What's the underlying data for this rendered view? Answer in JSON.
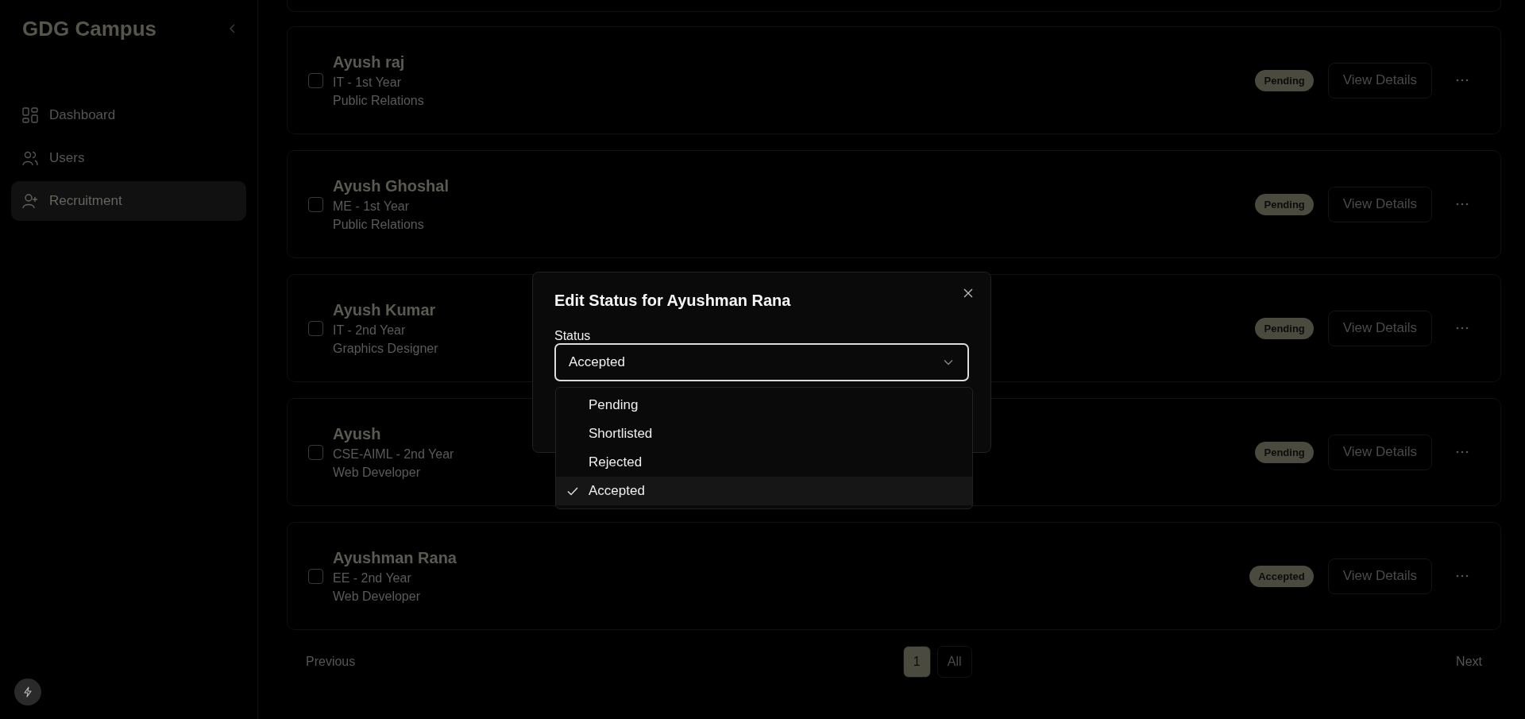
{
  "sidebar": {
    "title": "GDG Campus",
    "items": [
      {
        "label": "Dashboard",
        "selected": false
      },
      {
        "label": "Users",
        "selected": false
      },
      {
        "label": "Recruitment",
        "selected": true
      }
    ]
  },
  "applicants": [
    {
      "name": "Ayush raj",
      "details": "IT - 1st Year",
      "role": "Public Relations",
      "status": "Pending",
      "checked": false,
      "action": "View Details"
    },
    {
      "name": "Ayush Ghoshal",
      "details": "ME - 1st Year",
      "role": "Public Relations",
      "status": "Pending",
      "checked": false,
      "action": "View Details"
    },
    {
      "name": "Ayush Kumar",
      "details": "IT - 2nd Year",
      "role": "Graphics Designer",
      "status": "Pending",
      "checked": false,
      "action": "View Details"
    },
    {
      "name": "Ayush",
      "details": "CSE-AIML - 2nd Year",
      "role": "Web Developer",
      "status": "Pending",
      "checked": false,
      "action": "View Details"
    },
    {
      "name": "Ayushman Rana",
      "details": "EE - 2nd Year",
      "role": "Web Developer",
      "status": "Accepted",
      "checked": false,
      "action": "View Details"
    }
  ],
  "pagination": {
    "previous": "Previous",
    "pages": [
      {
        "label": "1",
        "selected": true
      },
      {
        "label": "All",
        "selected": false
      }
    ],
    "next": "Next"
  },
  "dialog": {
    "title": "Edit Status for Ayushman Rana",
    "field_label": "Status",
    "value": "Accepted",
    "expanded": true,
    "options": [
      {
        "label": "Pending",
        "selected": false
      },
      {
        "label": "Shortlisted",
        "selected": false
      },
      {
        "label": "Rejected",
        "selected": false
      },
      {
        "label": "Accepted",
        "selected": true
      }
    ]
  }
}
